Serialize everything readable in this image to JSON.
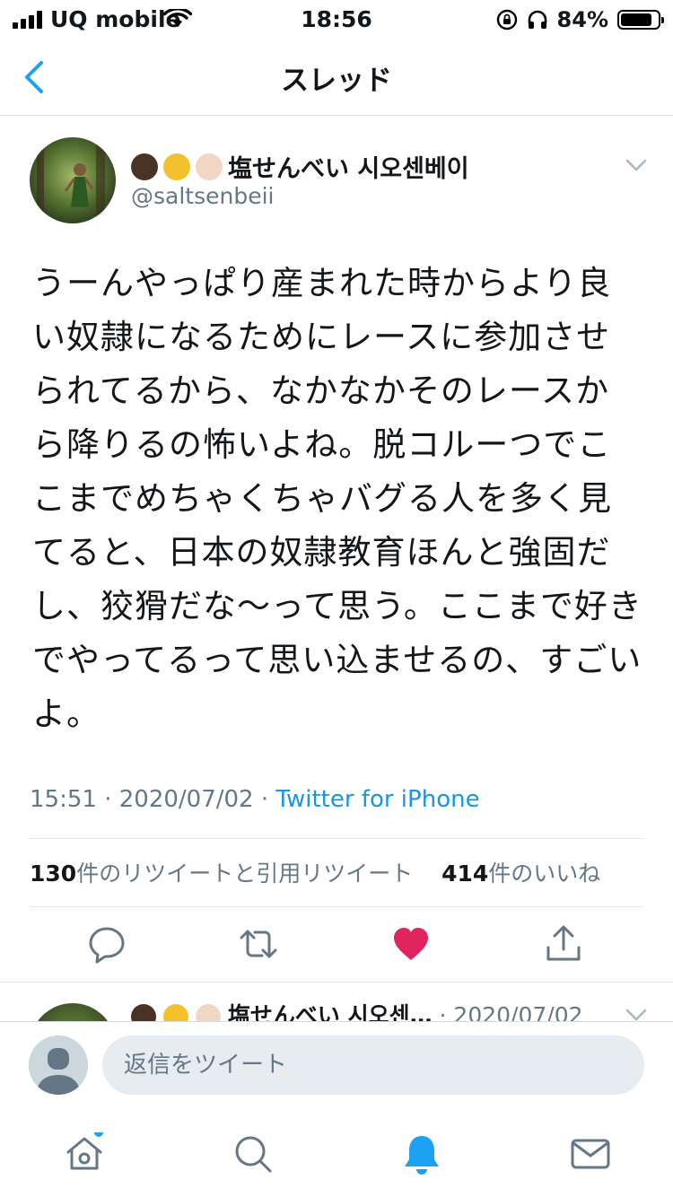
{
  "status_bar": {
    "carrier": "UQ mobile",
    "time": "18:56",
    "battery_percent": "84%",
    "battery_level": 0.84
  },
  "nav": {
    "title": "スレッド"
  },
  "tweet": {
    "emojis": [
      "raised-fist-dark",
      "raised-fist-medium-light",
      "raised-fist-light"
    ],
    "display_name": "塩せんべい 시오센베이",
    "handle": "@saltsenbeii",
    "body": "うーんやっぱり産まれた時からより良い奴隷になるためにレースに参加させられてるから、なかなかそのレースから降りるの怖いよね。脱コルーつでここまでめちゃくちゃバグる人を多く見てると、日本の奴隷教育ほんと強固だし、狡猾だな〜って思う。ここまで好きでやってるって思い込ませるの、すごいよ。",
    "time": "15:51",
    "date": "2020/07/02",
    "separator": " · ",
    "source": "Twitter for iPhone",
    "retweet_count": "130",
    "retweet_label": "件のリツイートと引用リツイート",
    "like_count": "414",
    "like_label": "件のいいね",
    "liked": true,
    "colors": {
      "accent": "#1da1f2",
      "like": "#e0245e",
      "muted": "#657786"
    }
  },
  "next_tweet": {
    "display_name": "塩せんべい 시오센…",
    "date": "· 2020/07/02"
  },
  "reply": {
    "placeholder": "返信をツイート"
  },
  "tabs": [
    {
      "icon": "home-icon",
      "has_badge": true
    },
    {
      "icon": "search-icon"
    },
    {
      "icon": "notifications-icon",
      "active": true
    },
    {
      "icon": "messages-icon"
    }
  ]
}
